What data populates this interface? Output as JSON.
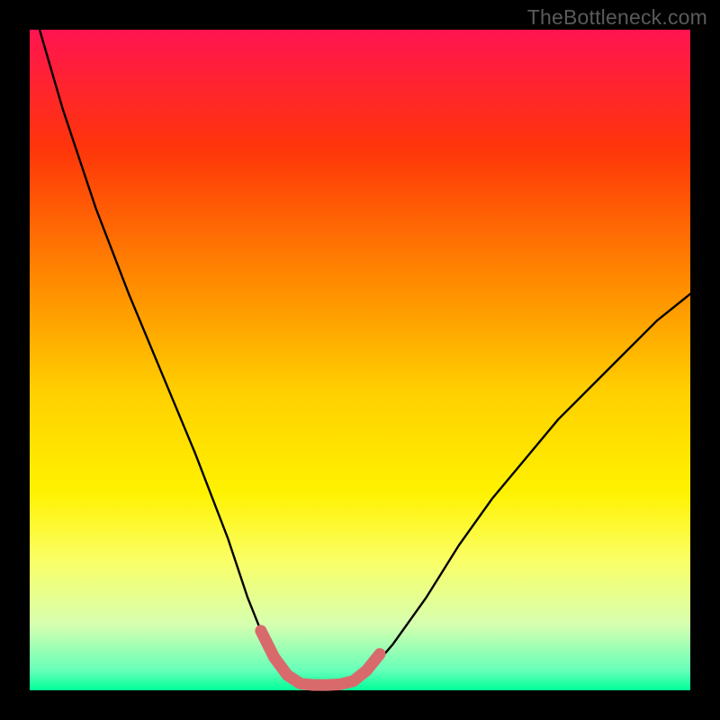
{
  "watermark": "TheBottleneck.com",
  "colors": {
    "page_bg": "#000000",
    "gradient_top": "#ff1450",
    "gradient_bottom": "#00ff99",
    "curve_stroke": "#000000",
    "highlight_stroke": "#d86a6c"
  },
  "chart_data": {
    "type": "line",
    "title": "",
    "xlabel": "",
    "ylabel": "",
    "xlim": [
      0,
      100
    ],
    "ylim": [
      0,
      100
    ],
    "grid": false,
    "legend": false,
    "annotations": [],
    "series": [
      {
        "name": "left-curve",
        "x": [
          1.5,
          5,
          10,
          15,
          20,
          25,
          30,
          33,
          35,
          37,
          39,
          41
        ],
        "y": [
          100,
          88,
          73,
          60,
          48,
          36,
          23,
          14,
          9,
          5,
          2.3,
          1
        ]
      },
      {
        "name": "right-curve",
        "x": [
          48,
          50,
          52,
          55,
          60,
          65,
          70,
          75,
          80,
          85,
          90,
          95,
          100
        ],
        "y": [
          1,
          2,
          3.5,
          7,
          14,
          22,
          29,
          35,
          41,
          46,
          51,
          56,
          60
        ]
      },
      {
        "name": "trough-highlight",
        "x": [
          35,
          37,
          39,
          41,
          43,
          45,
          47,
          49,
          51,
          53
        ],
        "y": [
          9,
          5,
          2.3,
          1,
          0.8,
          0.8,
          0.9,
          1.4,
          3,
          5.5
        ]
      }
    ]
  }
}
